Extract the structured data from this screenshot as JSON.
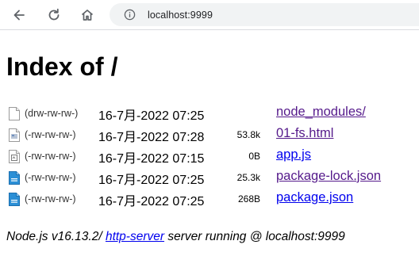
{
  "browser": {
    "url": "localhost:9999",
    "icons": {
      "back": "back-arrow-icon",
      "reload": "reload-icon",
      "home": "home-icon",
      "info": "info-icon"
    }
  },
  "page": {
    "title": "Index of /",
    "entries": [
      {
        "icon": "folder-icon",
        "perm": "(drw-rw-rw-)",
        "date": "16-7月-2022 07:25",
        "size": "",
        "name": "node_modules/",
        "visited": true
      },
      {
        "icon": "html-file-icon",
        "perm": "(-rw-rw-rw-)",
        "date": "16-7月-2022 07:28",
        "size": "53.8k",
        "name": "01-fs.html",
        "visited": true
      },
      {
        "icon": "js-file-icon",
        "perm": "(-rw-rw-rw-)",
        "date": "16-7月-2022 07:15",
        "size": "0B",
        "name": "app.js",
        "visited": false
      },
      {
        "icon": "json-file-icon",
        "perm": "(-rw-rw-rw-)",
        "date": "16-7月-2022 07:25",
        "size": "25.3k",
        "name": "package-lock.json",
        "visited": true
      },
      {
        "icon": "json-file-icon",
        "perm": "(-rw-rw-rw-)",
        "date": "16-7月-2022 07:25",
        "size": "268B",
        "name": "package.json",
        "visited": false
      }
    ],
    "footer": {
      "prefix": "Node.js v16.13.2/ ",
      "link": "http-server",
      "suffix": " server running @ localhost:9999"
    }
  },
  "colors": {
    "visited_link": "#551a8b",
    "unvisited_link": "#0000ee",
    "omnibox_bg": "#f1f3f4"
  }
}
